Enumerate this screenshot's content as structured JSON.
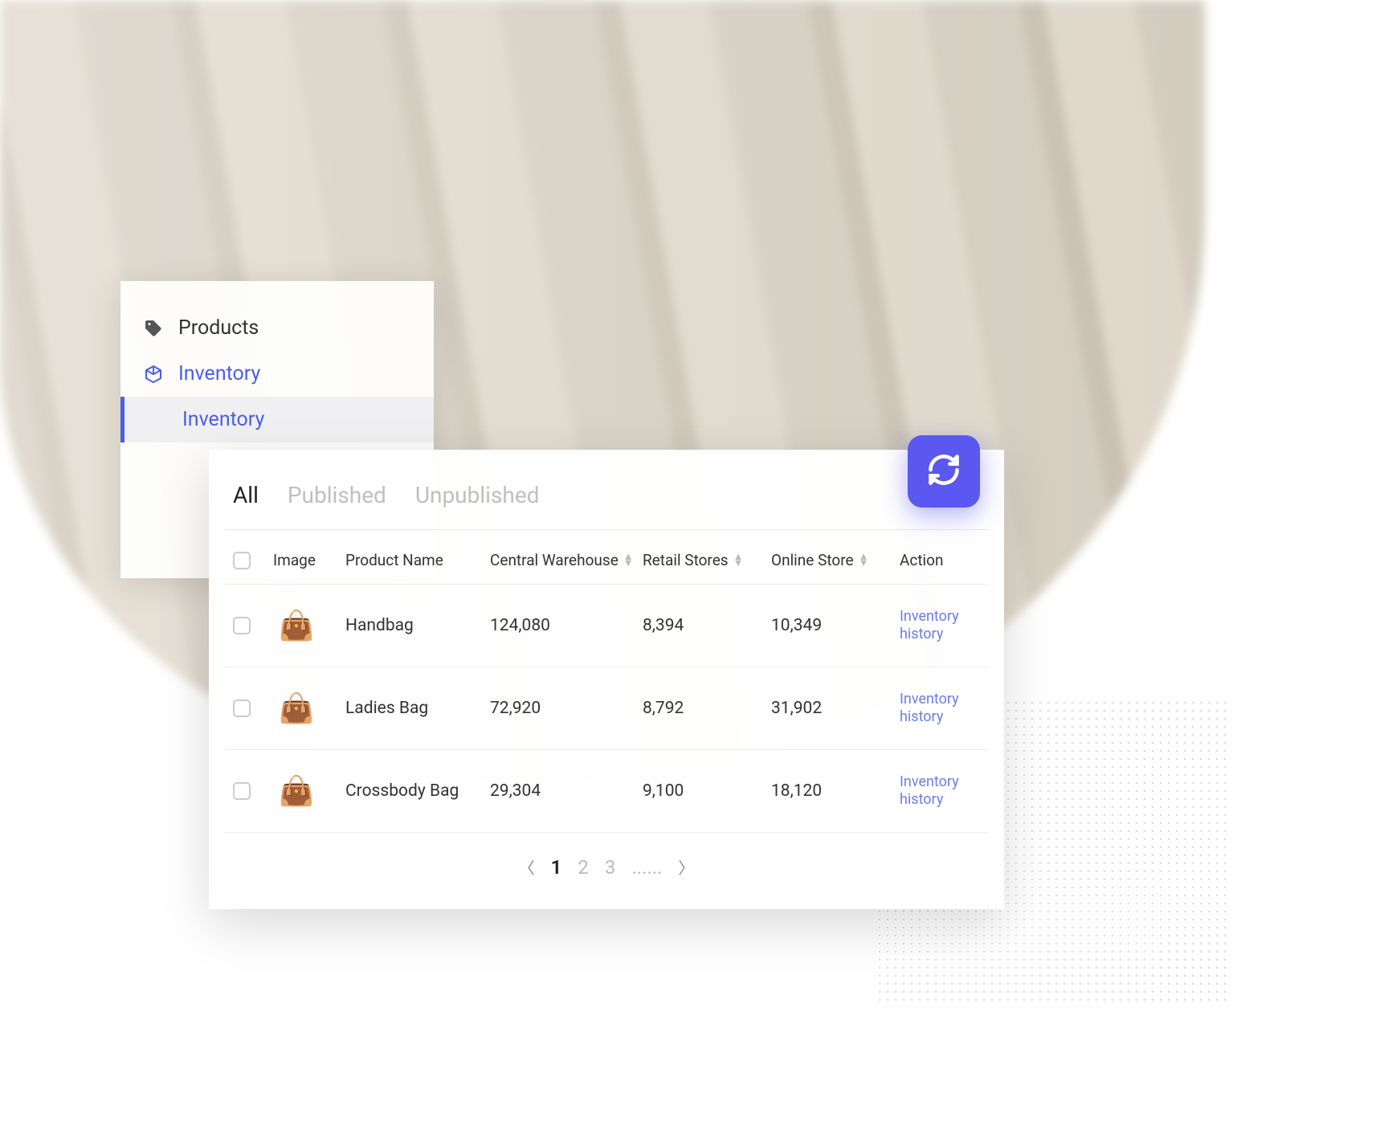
{
  "sidebar": {
    "items": [
      {
        "label": "Products",
        "icon": "tag"
      },
      {
        "label": "Inventory",
        "icon": "cube",
        "active": true
      }
    ],
    "subitem": {
      "label": "Inventory"
    }
  },
  "tabs": [
    {
      "label": "All",
      "active": true
    },
    {
      "label": "Published"
    },
    {
      "label": "Unpublished"
    }
  ],
  "columns": {
    "image": "Image",
    "name": "Product Name",
    "central": "Central Warehouse",
    "retail": "Retail Stores",
    "online": "Online Store",
    "action": "Action"
  },
  "rows": [
    {
      "thumb": "👜",
      "thumbColor": "#8a8576",
      "name": "Handbag",
      "central": "124,080",
      "retail": "8,394",
      "online": "10,349",
      "action": "Inventory history"
    },
    {
      "thumb": "👜",
      "thumbColor": "#d9d6cf",
      "name": "Ladies Bag",
      "central": "72,920",
      "retail": "8,792",
      "online": "31,902",
      "action": "Inventory history"
    },
    {
      "thumb": "👜",
      "thumbColor": "#d98a3f",
      "name": "Crossbody Bag",
      "central": "29,304",
      "retail": "9,100",
      "online": "18,120",
      "action": "Inventory history"
    }
  ],
  "pagination": {
    "pages": [
      "1",
      "2",
      "3"
    ],
    "ellipsis": "......",
    "current": "1"
  },
  "colors": {
    "accent": "#5a58f0",
    "link": "#6b7de8"
  }
}
